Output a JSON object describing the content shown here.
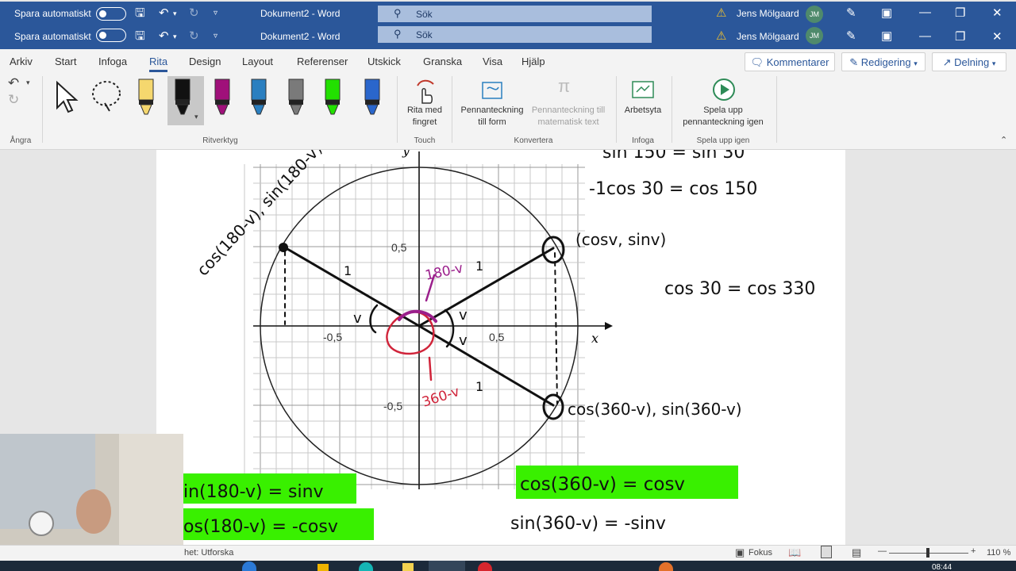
{
  "title_bars": [
    {
      "autosave_label": "Spara automatiskt",
      "doc_title": "Dokument2  -  Word",
      "search_placeholder": "Sök",
      "user_name": "Jens Mölgaard",
      "user_initials": "JM"
    },
    {
      "autosave_label": "Spara automatiskt",
      "doc_title": "Dokument2  -  Word",
      "search_placeholder": "Sök",
      "user_name": "Jens Mölgaard",
      "user_initials": "JM"
    }
  ],
  "menu": {
    "tabs": [
      "Arkiv",
      "Start",
      "Infoga",
      "Rita",
      "Design",
      "Layout",
      "Referenser",
      "Utskick",
      "Granska",
      "Visa",
      "Hjälp"
    ],
    "active_tab": "Rita",
    "comments_label": "Kommentarer",
    "editing_label": "Redigering",
    "share_label": "Delning"
  },
  "ribbon": {
    "undo_group_label": "Ångra",
    "tools_group_label": "Ritverktyg",
    "touch_group_label": "Touch",
    "draw_finger_label": "Rita med fingret",
    "convert_group_label": "Konvertera",
    "ink_to_shape_label": "Pennanteckning till form",
    "ink_to_math_label": "Pennanteckning till matematisk text",
    "insert_group_label": "Infoga",
    "canvas_label": "Arbetsyta",
    "replay_group_label": "Spela upp igen",
    "replay_label": "Spela upp pennanteckning igen",
    "pen_colors": [
      "#f5d76e",
      "#111111",
      "#a0107a",
      "#2a7fc0",
      "#7a7a7a",
      "#22e000",
      "#2a66cc"
    ]
  },
  "document": {
    "graph": {
      "x_axis_label": "x",
      "y_axis_label": "y",
      "x_ticks": [
        "-0,5",
        "0,5"
      ],
      "y_ticks": [
        "0,5",
        "-0,5"
      ]
    },
    "ink": {
      "top_left_point": "cos(180-v), sin(180-v)",
      "right_top_point": "(cosv, sinv)",
      "right_bottom_point": "cos(360-v), sin(360-v)",
      "angle_180": "180-v",
      "angle_360": "360-v",
      "v": "v",
      "one": "1",
      "eq1": "sin 150 = sin 30",
      "eq2": "-1cos 30 = cos 150",
      "eq3": "cos 30 = cos 330",
      "hl_right_1": "cos(360-v) = cosv",
      "right_2": "sin(360-v) = -sinv",
      "hl_left_1": "in(180-v) = sinv",
      "hl_left_2": "os(180-v) = -cosv"
    }
  },
  "status": {
    "left_text": "het: Utforska",
    "focus_label": "Fokus",
    "zoom": "110 %"
  },
  "taskbar": {
    "time": "08:44"
  }
}
